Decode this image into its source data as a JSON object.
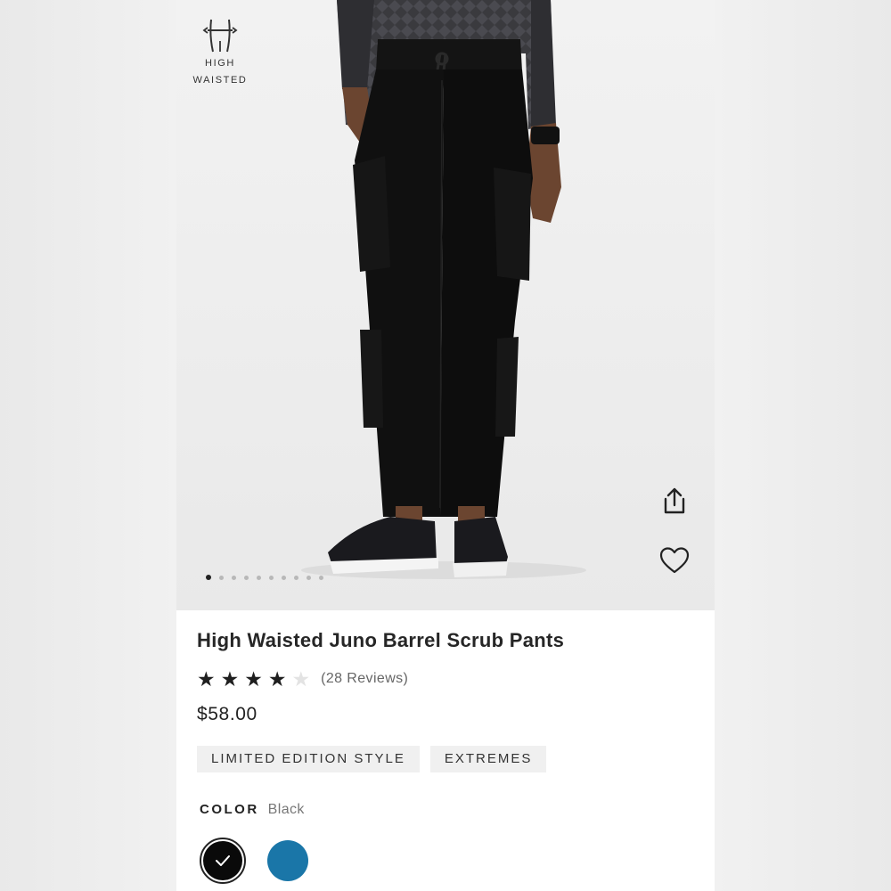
{
  "badge": {
    "line1": "HIGH",
    "line2": "WAISTED",
    "icon": "high-waist-icon"
  },
  "gallery": {
    "image_count": 10,
    "active_index": 0
  },
  "actions": {
    "share_icon": "share-icon",
    "favorite_icon": "heart-icon"
  },
  "product": {
    "title": "High Waisted Juno Barrel Scrub Pants",
    "rating": 4,
    "rating_max": 5,
    "reviews_label": "(28 Reviews)",
    "price": "$58.00",
    "tags": [
      "LIMITED EDITION STYLE",
      "EXTREMES"
    ]
  },
  "color": {
    "label": "COLOR",
    "selected": "Black",
    "swatches": [
      {
        "name": "Black",
        "hex": "#0a0a0a",
        "selected": true
      },
      {
        "name": "Caribbean Blue",
        "hex": "#1a76a8",
        "selected": false
      }
    ]
  }
}
